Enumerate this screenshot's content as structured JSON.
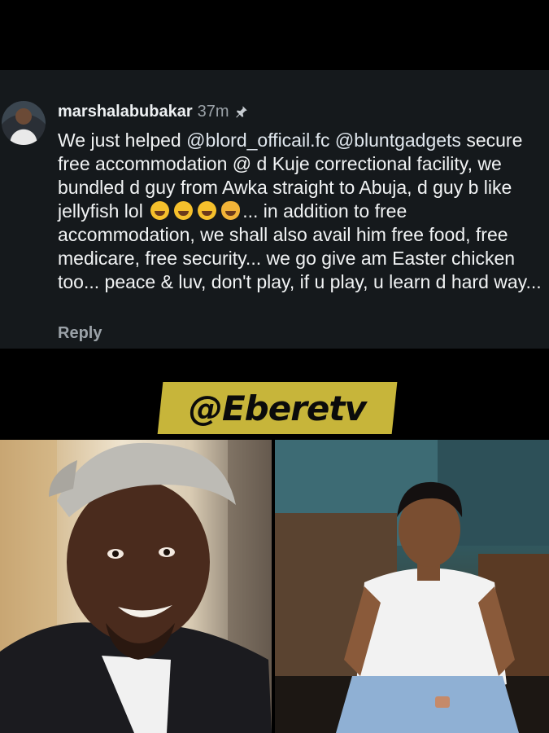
{
  "comment": {
    "username": "marshalabubakar",
    "time": "37m",
    "text_parts": {
      "p1": "We just helped ",
      "mention1": "@blord_officail.fc",
      "p2": " ",
      "mention2": "@bluntgadgets",
      "p3": " secure  free accommodation @ d Kuje correctional facility, we bundled d guy from Awka straight to Abuja, d guy b like jellyfish lol ",
      "p4": "... in addition to free accommodation,  we shall also avail him free food, free medicare, free security... we go give am Easter chicken too... peace & luv, don't play, if u play, u learn d hard way..."
    },
    "emojis": [
      "laughing-emoji",
      "rofl-emoji",
      "tears-of-joy-emoji",
      "cat-tears-emoji"
    ],
    "reply_label": "Reply",
    "icons": {
      "avatar": "avatar",
      "pin": "pin-icon"
    }
  },
  "watermark": {
    "text": "@Eberetv",
    "color": "#c7b53a"
  }
}
